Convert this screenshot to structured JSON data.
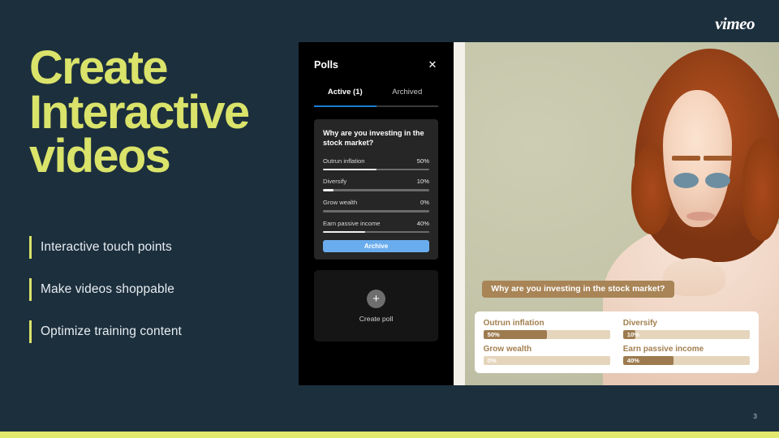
{
  "brand": {
    "logo_text": "vimeo"
  },
  "slide": {
    "headline_lines": [
      "Create",
      "Interactive",
      "videos"
    ],
    "page_number": "3",
    "accent_color": "#dae36a",
    "background_color": "#1c2f3d"
  },
  "bullets": [
    {
      "label": "Interactive touch points"
    },
    {
      "label": "Make videos shoppable"
    },
    {
      "label": "Optimize training content"
    }
  ],
  "polls_panel": {
    "title": "Polls",
    "close_icon": "close-icon",
    "tabs": [
      {
        "label": "Active (1)",
        "active": true
      },
      {
        "label": "Archived",
        "active": false
      }
    ],
    "active_tab_color": "#1a7fd4",
    "poll": {
      "question": "Why are you investing in the stock market?",
      "options": [
        {
          "label": "Outrun inflation",
          "percent_label": "50%",
          "percent": 50
        },
        {
          "label": "Diversify",
          "percent_label": "10%",
          "percent": 10
        },
        {
          "label": "Grow wealth",
          "percent_label": "0%",
          "percent": 0
        },
        {
          "label": "Earn passive income",
          "percent_label": "40%",
          "percent": 40
        }
      ],
      "archive_button_label": "Archive",
      "archive_button_color": "#6aadee"
    },
    "create": {
      "plus_icon": "plus-icon",
      "label": "Create poll"
    }
  },
  "video_overlay": {
    "question": "Why are you investing in the stock market?",
    "question_bg_color": "#a88456",
    "bar_fill_color": "#9d7b4f",
    "bar_track_color": "#e5d5bc",
    "options": [
      {
        "label": "Outrun inflation",
        "percent_label": "50%",
        "percent": 50
      },
      {
        "label": "Diversify",
        "percent_label": "10%",
        "percent": 10
      },
      {
        "label": "Grow wealth",
        "percent_label": "0%",
        "percent": 0
      },
      {
        "label": "Earn passive income",
        "percent_label": "40%",
        "percent": 40
      }
    ]
  }
}
